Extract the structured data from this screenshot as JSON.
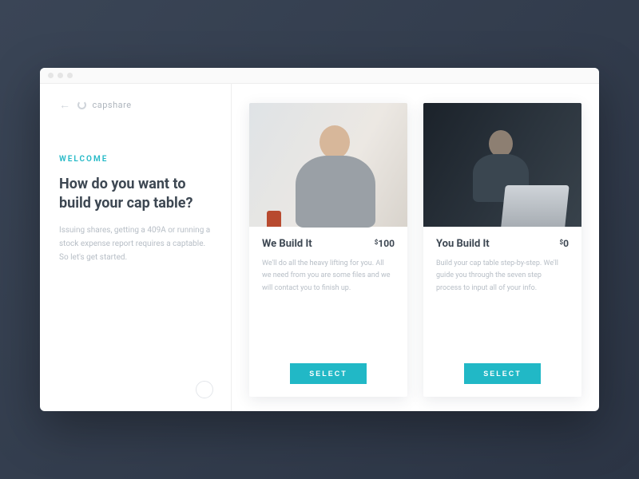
{
  "brand": {
    "name": "capshare"
  },
  "sidebar": {
    "eyebrow": "WELCOME",
    "headline": "How do you want to build your cap table?",
    "subcopy": "Issuing shares, getting a 409A or running a stock expense report requires a captable. So let's get started."
  },
  "cards": [
    {
      "title": "We Build It",
      "price_currency": "$",
      "price_amount": "100",
      "description": "We'll do all the heavy lifting for you. All we need from you are some files and we will contact you to finish up.",
      "button": "SELECT"
    },
    {
      "title": "You Build It",
      "price_currency": "$",
      "price_amount": "0",
      "description": "Build your cap table step-by-step. We'll guide you through the seven step process to input all of your info.",
      "button": "SELECT"
    }
  ],
  "colors": {
    "accent": "#21b8c6"
  }
}
